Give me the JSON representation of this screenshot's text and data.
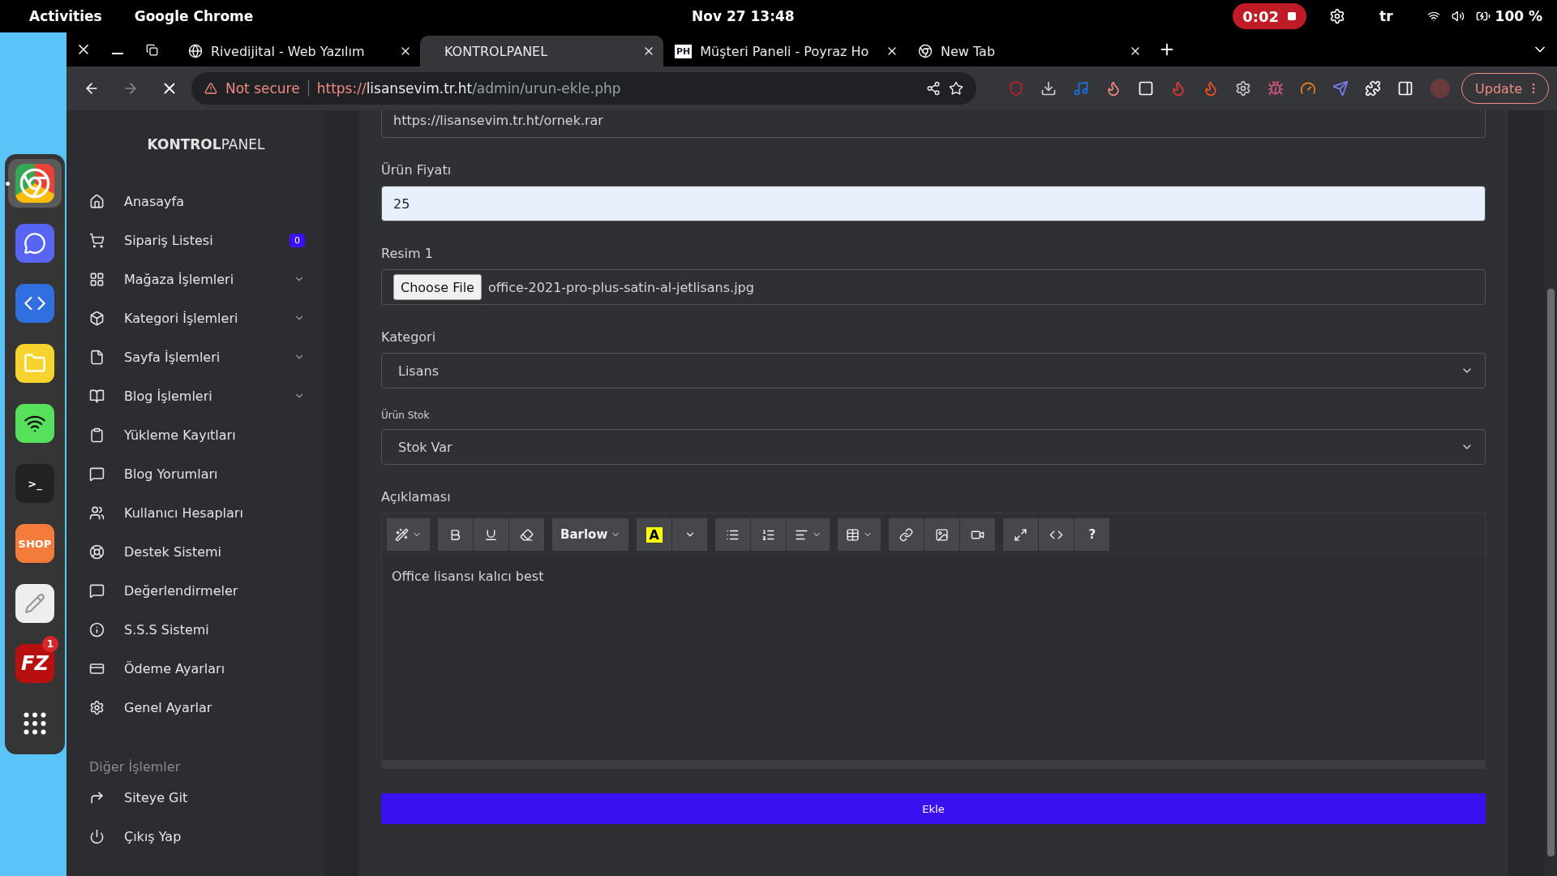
{
  "system_bar": {
    "activities": "Activities",
    "app": "Google Chrome",
    "clock": "Nov 27  13:48",
    "recording": "0:02",
    "language": "tr",
    "battery": "100 %"
  },
  "dock": {
    "items": [
      {
        "kind": "chrome",
        "selected": true
      },
      {
        "kind": "discord",
        "selected": false
      },
      {
        "kind": "vscode",
        "selected": false
      },
      {
        "kind": "files",
        "selected": false
      },
      {
        "kind": "spotify",
        "selected": false
      },
      {
        "kind": "terminal",
        "selected": false,
        "label": ">_"
      },
      {
        "kind": "shop",
        "selected": false,
        "label": "SHOP"
      },
      {
        "kind": "editor",
        "selected": false
      },
      {
        "kind": "filezilla",
        "selected": false,
        "label": "FZ",
        "badge": "1"
      },
      {
        "kind": "apps",
        "selected": false
      }
    ]
  },
  "browser": {
    "tabs": [
      {
        "title": "Rivedijital - Web Yazılım",
        "kind": "globe",
        "selected": false
      },
      {
        "title": "KONTROLPANEL",
        "kind": "blank",
        "selected": true
      },
      {
        "title": "Müşteri Paneli - Poyraz Ho",
        "kind": "ph",
        "badge": "PH",
        "selected": false
      },
      {
        "title": "New Tab",
        "kind": "chrome",
        "selected": false
      }
    ],
    "address": {
      "security": "Not secure",
      "scheme": "https://",
      "host": "lisansevim.tr.ht",
      "path": "/admin/urun-ekle.php"
    },
    "update": "Update"
  },
  "sidebar": {
    "brand_bold": "KONTROL",
    "brand_light": "PANEL",
    "items": [
      {
        "label": "Anasayfa",
        "kind": "home",
        "expandable": false
      },
      {
        "label": "Sipariş Listesi",
        "kind": "cart",
        "expandable": false,
        "badge": "0"
      },
      {
        "label": "Mağaza İşlemleri",
        "kind": "grid",
        "expandable": true
      },
      {
        "label": "Kategori İşlemleri",
        "kind": "box",
        "expandable": true
      },
      {
        "label": "Sayfa İşlemleri",
        "kind": "file",
        "expandable": true
      },
      {
        "label": "Blog İşlemleri",
        "kind": "book",
        "expandable": true
      },
      {
        "label": "Yükleme Kayıtları",
        "kind": "clipboard",
        "expandable": false
      },
      {
        "label": "Blog Yorumları",
        "kind": "chat",
        "expandable": false
      },
      {
        "label": "Kullanıcı Hesapları",
        "kind": "users",
        "expandable": false
      },
      {
        "label": "Destek Sistemi",
        "kind": "lifebuoy",
        "expandable": false
      },
      {
        "label": "Değerlendirmeler",
        "kind": "chat",
        "expandable": false
      },
      {
        "label": "S.S.S Sistemi",
        "kind": "info",
        "expandable": false
      },
      {
        "label": "Ödeme Ayarları",
        "kind": "card",
        "expandable": false
      },
      {
        "label": "Genel Ayarlar",
        "kind": "gear",
        "expandable": false
      }
    ],
    "section": "Diğer İşlemler",
    "other_items": [
      {
        "label": "Siteye Git",
        "kind": "forward",
        "expandable": false
      },
      {
        "label": "Çıkış Yap",
        "kind": "power",
        "expandable": false
      }
    ]
  },
  "form": {
    "fields": [
      {
        "kind": "text",
        "value": "https://lisansevim.tr.ht/ornek.rar"
      },
      {
        "kind": "text",
        "label": "Ürün Fiyatı",
        "value": "25",
        "focused": true
      },
      {
        "kind": "file",
        "label": "Resim 1",
        "button": "Choose File",
        "value": "office-2021-pro-plus-satin-al-jetlisans.jpg"
      },
      {
        "kind": "select",
        "label": "Kategori",
        "value": "Lisans"
      },
      {
        "kind": "select",
        "label": "Ürün Stok",
        "value": "Stok Var",
        "small_label": true
      }
    ],
    "editor": {
      "label": "Açıklaması",
      "toolbar": [
        [
          {
            "kind": "magic"
          }
        ],
        [
          {
            "kind": "bold"
          },
          {
            "kind": "underline"
          },
          {
            "kind": "eraser"
          }
        ],
        [
          {
            "kind": "font",
            "label": "Barlow"
          }
        ],
        [
          {
            "kind": "color",
            "label": "A"
          },
          {
            "kind": "caret"
          }
        ],
        [
          {
            "kind": "ul"
          },
          {
            "kind": "ol"
          },
          {
            "kind": "align"
          }
        ],
        [
          {
            "kind": "table"
          }
        ],
        [
          {
            "kind": "link"
          },
          {
            "kind": "image"
          },
          {
            "kind": "video"
          }
        ],
        [
          {
            "kind": "fullscreen"
          },
          {
            "kind": "code"
          },
          {
            "kind": "help",
            "label": "?"
          }
        ]
      ],
      "content": "Office lisansı kalıcı best"
    },
    "submit": "Ekle"
  }
}
